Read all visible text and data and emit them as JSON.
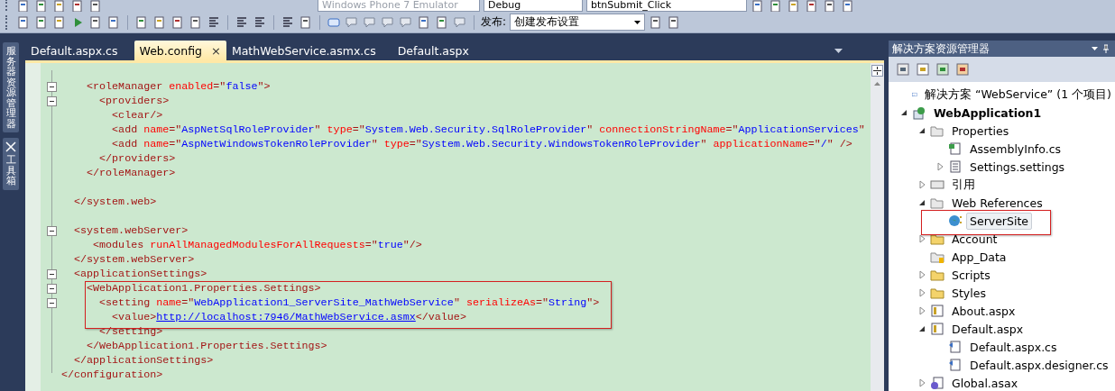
{
  "toolbar_top": {
    "combos": [
      {
        "value": "Windows Phone 7 Emulator",
        "disabled": true
      },
      {
        "value": "Debug",
        "disabled": false
      },
      {
        "value": "btnSubmit_Click",
        "disabled": false
      }
    ]
  },
  "toolbar_publish": {
    "label": "发布:",
    "combo": "创建发布设置"
  },
  "side_rail": [
    {
      "label": "服务器资源管理器",
      "selected": false
    },
    {
      "label": "工具箱",
      "selected": false
    }
  ],
  "tabs": [
    {
      "label": "Default.aspx.cs",
      "selected": false
    },
    {
      "label": "Web.config",
      "selected": true,
      "close": "×"
    },
    {
      "label": "MathWebService.asmx.cs",
      "selected": false
    },
    {
      "label": "Default.aspx",
      "selected": false
    }
  ],
  "editor": {
    "lines": [
      {
        "fold": false
      },
      {
        "fold": true,
        "tokens": [
          {
            "kind": "tag",
            "text": "    <roleManager "
          },
          {
            "kind": "attr",
            "text": "enabled"
          },
          {
            "kind": "tag",
            "text": "=\""
          },
          {
            "kind": "value",
            "text": "false"
          },
          {
            "kind": "tag",
            "text": "\">"
          }
        ]
      },
      {
        "fold": true,
        "tokens": [
          {
            "kind": "tag",
            "text": "      <providers>"
          }
        ]
      },
      {
        "fold": false,
        "tokens": [
          {
            "kind": "tag",
            "text": "        <clear/>"
          }
        ]
      },
      {
        "fold": false,
        "tokens": [
          {
            "kind": "tag",
            "text": "        <add "
          },
          {
            "kind": "attr",
            "text": "name"
          },
          {
            "kind": "tag",
            "text": "=\""
          },
          {
            "kind": "value",
            "text": "AspNetSqlRoleProvider"
          },
          {
            "kind": "tag",
            "text": "\" "
          },
          {
            "kind": "attr",
            "text": "type"
          },
          {
            "kind": "tag",
            "text": "=\""
          },
          {
            "kind": "value",
            "text": "System.Web.Security.SqlRoleProvider"
          },
          {
            "kind": "tag",
            "text": "\" "
          },
          {
            "kind": "attr",
            "text": "connectionStringName"
          },
          {
            "kind": "tag",
            "text": "=\""
          },
          {
            "kind": "value",
            "text": "ApplicationServices"
          },
          {
            "kind": "tag",
            "text": "\""
          }
        ]
      },
      {
        "fold": false,
        "tokens": [
          {
            "kind": "tag",
            "text": "        <add "
          },
          {
            "kind": "attr",
            "text": "name"
          },
          {
            "kind": "tag",
            "text": "=\""
          },
          {
            "kind": "value",
            "text": "AspNetWindowsTokenRoleProvider"
          },
          {
            "kind": "tag",
            "text": "\" "
          },
          {
            "kind": "attr",
            "text": "type"
          },
          {
            "kind": "tag",
            "text": "=\""
          },
          {
            "kind": "value",
            "text": "System.Web.Security.WindowsTokenRoleProvider"
          },
          {
            "kind": "tag",
            "text": "\" "
          },
          {
            "kind": "attr",
            "text": "applicationName"
          },
          {
            "kind": "tag",
            "text": "=\""
          },
          {
            "kind": "value",
            "text": "/"
          },
          {
            "kind": "tag",
            "text": "\" />"
          }
        ]
      },
      {
        "fold": false,
        "tokens": [
          {
            "kind": "tag",
            "text": "      </providers>"
          }
        ]
      },
      {
        "fold": false,
        "tokens": [
          {
            "kind": "tag",
            "text": "    </roleManager>"
          }
        ]
      },
      {
        "fold": false
      },
      {
        "fold": false,
        "tokens": [
          {
            "kind": "tag",
            "text": "  </system.web>"
          }
        ]
      },
      {
        "fold": false
      },
      {
        "fold": true,
        "tokens": [
          {
            "kind": "tag",
            "text": "  <system.webServer>"
          }
        ]
      },
      {
        "fold": false,
        "tokens": [
          {
            "kind": "tag",
            "text": "     <modules "
          },
          {
            "kind": "attr",
            "text": "runAllManagedModulesForAllRequests"
          },
          {
            "kind": "tag",
            "text": "=\""
          },
          {
            "kind": "value",
            "text": "true"
          },
          {
            "kind": "tag",
            "text": "\"/>"
          }
        ]
      },
      {
        "fold": false,
        "tokens": [
          {
            "kind": "tag",
            "text": "  </system.webServer>"
          }
        ]
      },
      {
        "fold": true,
        "tokens": [
          {
            "kind": "tag",
            "text": "  <applicationSettings>"
          }
        ]
      },
      {
        "fold": true,
        "tokens": [
          {
            "kind": "tag",
            "text": "    <WebApplication1.Properties.Settings>"
          }
        ]
      },
      {
        "fold": true,
        "tokens": [
          {
            "kind": "tag",
            "text": "      <setting "
          },
          {
            "kind": "attr",
            "text": "name"
          },
          {
            "kind": "tag",
            "text": "=\""
          },
          {
            "kind": "value",
            "text": "WebApplication1_ServerSite_MathWebService"
          },
          {
            "kind": "tag",
            "text": "\" "
          },
          {
            "kind": "attr",
            "text": "serializeAs"
          },
          {
            "kind": "tag",
            "text": "=\""
          },
          {
            "kind": "value",
            "text": "String"
          },
          {
            "kind": "tag",
            "text": "\">"
          }
        ]
      },
      {
        "fold": false,
        "tokens": [
          {
            "kind": "tag",
            "text": "        <value>"
          },
          {
            "kind": "link",
            "text": "http://localhost:7946/MathWebService.asmx"
          },
          {
            "kind": "tag",
            "text": "</value>"
          }
        ]
      },
      {
        "fold": false,
        "tokens": [
          {
            "kind": "tag",
            "text": "      </setting>"
          }
        ]
      },
      {
        "fold": false,
        "tokens": [
          {
            "kind": "tag",
            "text": "    </WebApplication1.Properties.Settings>"
          }
        ]
      },
      {
        "fold": false,
        "tokens": [
          {
            "kind": "tag",
            "text": "  </applicationSettings>"
          }
        ]
      },
      {
        "fold": false,
        "tokens": [
          {
            "kind": "tag",
            "text": "</configuration>"
          }
        ]
      }
    ]
  },
  "solution_explorer": {
    "title": "解决方案资源管理器",
    "items": [
      {
        "label": "解决方案 “WebService” (1 个项目)",
        "kind": "solution",
        "selected": false
      },
      {
        "label": "WebApplication1",
        "kind": "project",
        "expanded": true,
        "selected": false,
        "children": [
          {
            "label": "Properties",
            "kind": "open-folder",
            "expanded": true,
            "selected": false,
            "children": [
              {
                "label": "AssemblyInfo.cs",
                "kind": "code",
                "selected": false
              },
              {
                "label": "Settings.settings",
                "kind": "doc",
                "expanded": false,
                "selected": false
              }
            ]
          },
          {
            "label": "引用",
            "kind": "refs",
            "expanded": false,
            "selected": false
          },
          {
            "label": "Web References",
            "kind": "open-folder",
            "expanded": true,
            "selected": false,
            "children": [
              {
                "label": "ServerSite",
                "kind": "globe",
                "selected": true
              }
            ]
          },
          {
            "label": "Account",
            "kind": "folder",
            "expanded": false,
            "selected": false
          },
          {
            "label": "App_Data",
            "kind": "data-folder",
            "selected": false
          },
          {
            "label": "Scripts",
            "kind": "folder",
            "expanded": false,
            "selected": false
          },
          {
            "label": "Styles",
            "kind": "folder",
            "expanded": false,
            "selected": false
          },
          {
            "label": "About.aspx",
            "kind": "page",
            "expanded": false,
            "selected": false
          },
          {
            "label": "Default.aspx",
            "kind": "page",
            "expanded": true,
            "selected": false,
            "children": [
              {
                "label": "Default.aspx.cs",
                "kind": "code-behind",
                "selected": false
              },
              {
                "label": "Default.aspx.designer.cs",
                "kind": "code-behind",
                "selected": false
              }
            ]
          },
          {
            "label": "Global.asax",
            "kind": "gear-file",
            "expanded": false,
            "selected": false
          }
        ]
      }
    ]
  }
}
